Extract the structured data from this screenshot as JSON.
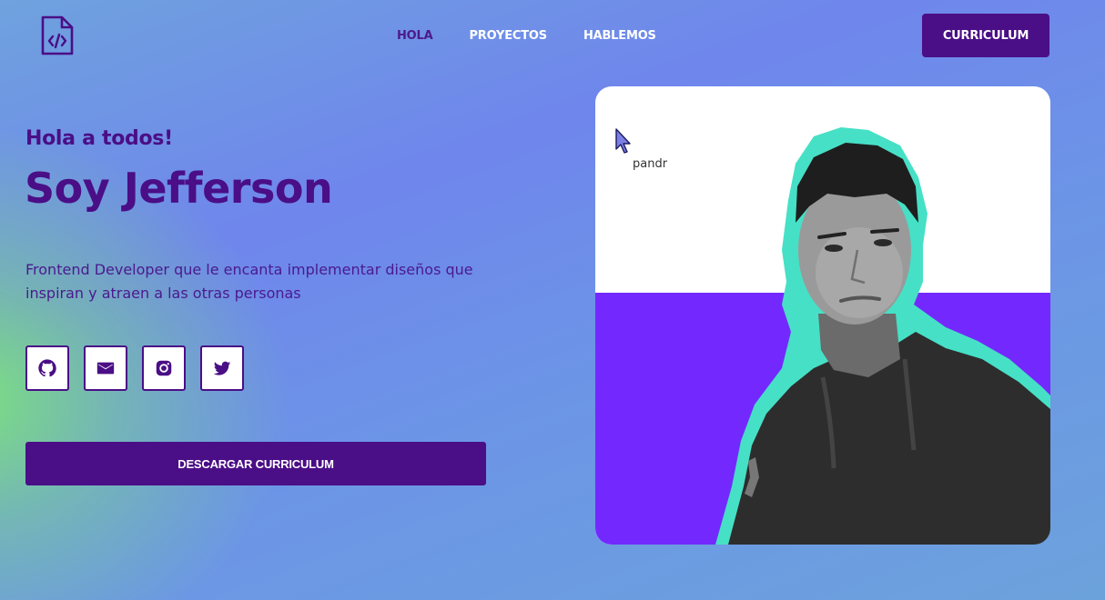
{
  "nav": {
    "items": [
      {
        "label": "HOLA",
        "active": true
      },
      {
        "label": "PROYECTOS",
        "active": false
      },
      {
        "label": "HABLEMOS",
        "active": false
      }
    ],
    "cv_button": "CURRICULUM"
  },
  "hero": {
    "greeting": "Hola a todos!",
    "name": "Soy Jefferson",
    "description": "Frontend Developer que le encanta implementar diseños que inspiran y atraen a las otras personas",
    "download_button": "DESCARGAR CURRICULUM",
    "socials": [
      {
        "icon": "github-icon"
      },
      {
        "icon": "mail-icon"
      },
      {
        "icon": "instagram-icon"
      },
      {
        "icon": "twitter-icon"
      }
    ]
  },
  "photo": {
    "cursor_label": "pandr"
  },
  "colors": {
    "primary": "#4a0e86",
    "photo_bottom": "#7329fe",
    "outline": "#46e0c6"
  }
}
